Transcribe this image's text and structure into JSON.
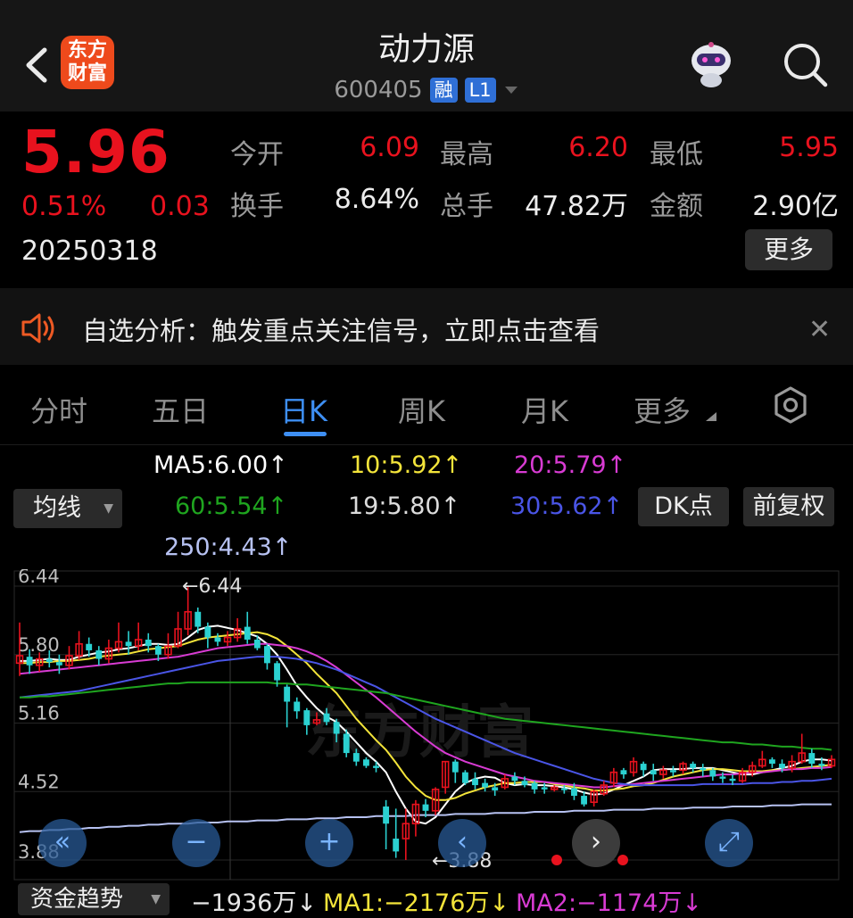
{
  "header": {
    "logo_line1": "东方",
    "logo_line2": "财富",
    "title": "动力源",
    "code": "600405",
    "tag1": "融",
    "tag2": "L1"
  },
  "quote": {
    "price": "5.96",
    "change_pct": "0.51%",
    "change": "0.03",
    "date": "20250318",
    "open_label": "今开",
    "open": "6.09",
    "high_label": "最高",
    "high": "6.20",
    "low_label": "最低",
    "low": "5.95",
    "turnover_label": "换手",
    "turnover": "8.64%",
    "volume_label": "总手",
    "volume": "47.82万",
    "amount_label": "金额",
    "amount": "2.90亿",
    "more_label": "更多"
  },
  "banner": {
    "text": "自选分析：触发重点关注信号，立即点击查看"
  },
  "tabs": [
    "分时",
    "五日",
    "日K",
    "周K",
    "月K",
    "更多"
  ],
  "active_tab": "日K",
  "ma_legend": {
    "ma5": "MA5:6.00↑",
    "ma10": "10:5.92↑",
    "ma20": "20:5.79↑",
    "ma60": "60:5.54↑",
    "ma19": "19:5.80↑",
    "ma30": "30:5.62↑",
    "ma250": "250:4.43↑",
    "line_select": "均线",
    "dk_button": "DK点",
    "adjust_button": "前复权"
  },
  "colors": {
    "up": "#e8121e",
    "down": "#2bd1d1",
    "ma5": "#ffffff",
    "ma10": "#f3e43a",
    "ma20": "#d83bd3",
    "ma60": "#1fa51f",
    "ma30": "#4a55e6",
    "ma250": "#b7c2f2",
    "accent": "#3e8ff3"
  },
  "chart_data": {
    "type": "candlestick",
    "y_ticks": [
      "6.44",
      "5.80",
      "5.16",
      "4.52",
      "3.88"
    ],
    "ylim": [
      3.88,
      6.44
    ],
    "max_label": "←6.44",
    "min_label": "←3.88",
    "watermark": "东方财富",
    "candles": [
      [
        5.72,
        5.79,
        6.1,
        5.6
      ],
      [
        5.78,
        5.7,
        5.85,
        5.62
      ],
      [
        5.7,
        5.76,
        5.82,
        5.64
      ],
      [
        5.76,
        5.73,
        5.84,
        5.68
      ],
      [
        5.73,
        5.7,
        5.8,
        5.62
      ],
      [
        5.7,
        5.79,
        5.88,
        5.66
      ],
      [
        5.79,
        5.9,
        6.02,
        5.75
      ],
      [
        5.9,
        5.84,
        5.96,
        5.78
      ],
      [
        5.84,
        5.76,
        5.88,
        5.7
      ],
      [
        5.76,
        5.86,
        5.94,
        5.72
      ],
      [
        5.86,
        5.92,
        6.1,
        5.82
      ],
      [
        5.92,
        5.88,
        6.02,
        5.8
      ],
      [
        5.88,
        5.94,
        6.1,
        5.84
      ],
      [
        5.94,
        5.88,
        6.0,
        5.82
      ],
      [
        5.88,
        5.8,
        5.9,
        5.74
      ],
      [
        5.8,
        5.88,
        6.0,
        5.76
      ],
      [
        5.88,
        6.04,
        6.2,
        5.86
      ],
      [
        6.04,
        6.2,
        6.44,
        5.98
      ],
      [
        6.2,
        6.06,
        6.24,
        6.0
      ],
      [
        6.06,
        5.96,
        6.1,
        5.86
      ],
      [
        5.96,
        5.92,
        6.0,
        5.88
      ],
      [
        5.92,
        5.96,
        6.02,
        5.88
      ],
      [
        5.96,
        6.04,
        6.14,
        5.92
      ],
      [
        6.06,
        5.94,
        6.2,
        5.9
      ],
      [
        5.94,
        5.86,
        5.98,
        5.84
      ],
      [
        5.88,
        5.72,
        5.9,
        5.66
      ],
      [
        5.72,
        5.56,
        5.74,
        5.5
      ],
      [
        5.5,
        5.36,
        5.52,
        5.12
      ],
      [
        5.36,
        5.27,
        5.4,
        5.2
      ],
      [
        5.28,
        5.14,
        5.3,
        5.05
      ],
      [
        5.16,
        5.19,
        5.26,
        5.14
      ],
      [
        5.25,
        5.17,
        5.3,
        5.14
      ],
      [
        5.17,
        5.06,
        5.2,
        4.98
      ],
      [
        5.06,
        4.88,
        5.1,
        4.84
      ],
      [
        4.88,
        4.8,
        4.92,
        4.76
      ],
      [
        4.82,
        4.76,
        4.84,
        4.74
      ],
      [
        4.76,
        4.74,
        4.8,
        4.7
      ],
      [
        4.38,
        4.22,
        4.44,
        3.98
      ],
      [
        4.08,
        3.96,
        4.36,
        3.9
      ],
      [
        4.08,
        4.22,
        4.36,
        3.88
      ],
      [
        4.22,
        4.4,
        4.44,
        4.1
      ],
      [
        4.4,
        4.34,
        4.45,
        4.28
      ],
      [
        4.34,
        4.54,
        4.56,
        4.3
      ],
      [
        4.56,
        4.8,
        4.8,
        4.5
      ],
      [
        4.8,
        4.7,
        4.82,
        4.6
      ],
      [
        4.7,
        4.6,
        4.72,
        4.58
      ],
      [
        4.64,
        4.58,
        4.7,
        4.54
      ],
      [
        4.6,
        4.56,
        4.64,
        4.52
      ],
      [
        4.56,
        4.53,
        4.6,
        4.48
      ],
      [
        4.56,
        4.64,
        4.68,
        4.54
      ],
      [
        4.66,
        4.62,
        4.7,
        4.58
      ],
      [
        4.62,
        4.58,
        4.66,
        4.56
      ],
      [
        4.6,
        4.54,
        4.62,
        4.5
      ],
      [
        4.56,
        4.54,
        4.6,
        4.5
      ],
      [
        4.54,
        4.56,
        4.58,
        4.52
      ],
      [
        4.55,
        4.54,
        4.58,
        4.5
      ],
      [
        4.55,
        4.48,
        4.6,
        4.44
      ],
      [
        4.48,
        4.4,
        4.52,
        4.38
      ],
      [
        4.42,
        4.52,
        4.54,
        4.38
      ],
      [
        4.5,
        4.58,
        4.62,
        4.48
      ],
      [
        4.6,
        4.7,
        4.74,
        4.56
      ],
      [
        4.72,
        4.68,
        4.74,
        4.64
      ],
      [
        4.7,
        4.8,
        4.84,
        4.66
      ],
      [
        4.78,
        4.72,
        4.8,
        4.66
      ],
      [
        4.72,
        4.68,
        4.78,
        4.62
      ],
      [
        4.68,
        4.72,
        4.76,
        4.64
      ],
      [
        4.72,
        4.7,
        4.76,
        4.66
      ],
      [
        4.72,
        4.78,
        4.8,
        4.68
      ],
      [
        4.78,
        4.74,
        4.8,
        4.7
      ],
      [
        4.74,
        4.72,
        4.78,
        4.66
      ],
      [
        4.72,
        4.66,
        4.74,
        4.62
      ],
      [
        4.66,
        4.64,
        4.7,
        4.6
      ],
      [
        4.64,
        4.62,
        4.68,
        4.58
      ],
      [
        4.62,
        4.7,
        4.74,
        4.6
      ],
      [
        4.7,
        4.76,
        4.8,
        4.66
      ],
      [
        4.76,
        4.82,
        4.9,
        4.74
      ],
      [
        4.82,
        4.78,
        4.84,
        4.74
      ],
      [
        4.78,
        4.74,
        4.82,
        4.7
      ],
      [
        4.74,
        4.8,
        4.86,
        4.7
      ],
      [
        4.8,
        4.88,
        5.06,
        4.78
      ],
      [
        4.88,
        4.78,
        4.92,
        4.74
      ],
      [
        4.78,
        4.76,
        4.84,
        4.72
      ],
      [
        4.76,
        4.82,
        4.86,
        4.74
      ]
    ],
    "series": [
      {
        "name": "MA5",
        "color": "#ffffff",
        "values": [
          5.74,
          5.74,
          5.75,
          5.76,
          5.75,
          5.75,
          5.78,
          5.8,
          5.82,
          5.83,
          5.85,
          5.86,
          5.88,
          5.9,
          5.9,
          5.89,
          5.9,
          5.96,
          6.03,
          6.06,
          6.07,
          6.05,
          6.03,
          6.0,
          5.97,
          5.9,
          5.8,
          5.66,
          5.51,
          5.4,
          5.3,
          5.22,
          5.17,
          5.08,
          4.98,
          4.88,
          4.8,
          4.7,
          4.52,
          4.36,
          4.24,
          4.22,
          4.28,
          4.4,
          4.52,
          4.6,
          4.64,
          4.66,
          4.65,
          4.6,
          4.58,
          4.59,
          4.58,
          4.58,
          4.57,
          4.56,
          4.54,
          4.51,
          4.49,
          4.5,
          4.54,
          4.58,
          4.62,
          4.66,
          4.72,
          4.73,
          4.73,
          4.73,
          4.74,
          4.74,
          4.74,
          4.72,
          4.7,
          4.68,
          4.68,
          4.7,
          4.72,
          4.74,
          4.76,
          4.8,
          4.82,
          4.82,
          4.81
        ]
      },
      {
        "name": "MA10",
        "color": "#f3e43a",
        "values": [
          5.72,
          5.72,
          5.73,
          5.73,
          5.74,
          5.74,
          5.75,
          5.76,
          5.78,
          5.79,
          5.8,
          5.81,
          5.83,
          5.85,
          5.86,
          5.87,
          5.88,
          5.91,
          5.94,
          5.96,
          5.97,
          5.98,
          5.99,
          6.0,
          6.01,
          5.99,
          5.95,
          5.88,
          5.8,
          5.72,
          5.62,
          5.53,
          5.44,
          5.32,
          5.2,
          5.1,
          5.0,
          4.91,
          4.79,
          4.66,
          4.56,
          4.48,
          4.44,
          4.44,
          4.46,
          4.5,
          4.53,
          4.56,
          4.58,
          4.6,
          4.6,
          4.61,
          4.61,
          4.61,
          4.59,
          4.58,
          4.56,
          4.55,
          4.53,
          4.53,
          4.54,
          4.55,
          4.57,
          4.58,
          4.6,
          4.63,
          4.66,
          4.68,
          4.7,
          4.72,
          4.73,
          4.73,
          4.72,
          4.71,
          4.71,
          4.71,
          4.72,
          4.72,
          4.73,
          4.74,
          4.75,
          4.76,
          4.77
        ]
      },
      {
        "name": "MA20",
        "color": "#d83bd3",
        "values": [
          5.62,
          5.63,
          5.64,
          5.65,
          5.66,
          5.67,
          5.68,
          5.69,
          5.7,
          5.71,
          5.72,
          5.73,
          5.74,
          5.75,
          5.76,
          5.77,
          5.78,
          5.8,
          5.82,
          5.84,
          5.86,
          5.87,
          5.88,
          5.89,
          5.9,
          5.9,
          5.89,
          5.88,
          5.86,
          5.83,
          5.79,
          5.74,
          5.68,
          5.61,
          5.54,
          5.47,
          5.4,
          5.32,
          5.24,
          5.16,
          5.08,
          5.01,
          4.94,
          4.88,
          4.84,
          4.8,
          4.77,
          4.74,
          4.71,
          4.68,
          4.66,
          4.64,
          4.62,
          4.61,
          4.6,
          4.59,
          4.58,
          4.57,
          4.56,
          4.56,
          4.57,
          4.58,
          4.59,
          4.6,
          4.61,
          4.62,
          4.63,
          4.64,
          4.65,
          4.66,
          4.67,
          4.68,
          4.68,
          4.69,
          4.7,
          4.7,
          4.71,
          4.72,
          4.73,
          4.73,
          4.74,
          4.74,
          4.75
        ]
      },
      {
        "name": "MA30",
        "color": "#4a55e6",
        "values": [
          5.4,
          5.41,
          5.42,
          5.43,
          5.44,
          5.45,
          5.46,
          5.48,
          5.5,
          5.52,
          5.54,
          5.56,
          5.58,
          5.6,
          5.62,
          5.64,
          5.66,
          5.68,
          5.7,
          5.72,
          5.74,
          5.75,
          5.76,
          5.77,
          5.78,
          5.78,
          5.78,
          5.77,
          5.76,
          5.74,
          5.72,
          5.69,
          5.66,
          5.62,
          5.58,
          5.54,
          5.5,
          5.45,
          5.4,
          5.35,
          5.3,
          5.25,
          5.2,
          5.16,
          5.12,
          5.08,
          5.04,
          5.0,
          4.96,
          4.92,
          4.88,
          4.85,
          4.82,
          4.79,
          4.76,
          4.73,
          4.7,
          4.67,
          4.64,
          4.62,
          4.6,
          4.59,
          4.58,
          4.58,
          4.58,
          4.58,
          4.58,
          4.58,
          4.58,
          4.59,
          4.59,
          4.59,
          4.59,
          4.59,
          4.6,
          4.6,
          4.6,
          4.61,
          4.61,
          4.62,
          4.62,
          4.63,
          4.64
        ]
      },
      {
        "name": "MA60",
        "color": "#1fa51f",
        "values": [
          5.4,
          5.4,
          5.41,
          5.41,
          5.42,
          5.43,
          5.44,
          5.45,
          5.46,
          5.47,
          5.48,
          5.49,
          5.5,
          5.51,
          5.52,
          5.53,
          5.53,
          5.54,
          5.54,
          5.54,
          5.54,
          5.54,
          5.54,
          5.54,
          5.54,
          5.54,
          5.53,
          5.53,
          5.52,
          5.52,
          5.51,
          5.5,
          5.49,
          5.48,
          5.47,
          5.46,
          5.45,
          5.44,
          5.42,
          5.4,
          5.38,
          5.36,
          5.34,
          5.32,
          5.3,
          5.28,
          5.26,
          5.24,
          5.22,
          5.2,
          5.19,
          5.18,
          5.17,
          5.16,
          5.15,
          5.14,
          5.13,
          5.12,
          5.11,
          5.1,
          5.09,
          5.08,
          5.07,
          5.06,
          5.05,
          5.04,
          5.03,
          5.02,
          5.01,
          5.0,
          4.99,
          4.98,
          4.98,
          4.97,
          4.96,
          4.96,
          4.95,
          4.94,
          4.94,
          4.93,
          4.92,
          4.92,
          4.91
        ]
      },
      {
        "name": "MA250",
        "color": "#b7c2f2",
        "values": [
          4.14,
          4.15,
          4.15,
          4.16,
          4.16,
          4.17,
          4.17,
          4.18,
          4.18,
          4.19,
          4.19,
          4.2,
          4.2,
          4.21,
          4.21,
          4.22,
          4.22,
          4.22,
          4.23,
          4.23,
          4.23,
          4.24,
          4.24,
          4.24,
          4.25,
          4.25,
          4.25,
          4.26,
          4.26,
          4.26,
          4.27,
          4.27,
          4.27,
          4.28,
          4.28,
          4.28,
          4.29,
          4.29,
          4.29,
          4.29,
          4.3,
          4.3,
          4.3,
          4.3,
          4.31,
          4.31,
          4.31,
          4.31,
          4.32,
          4.32,
          4.32,
          4.32,
          4.33,
          4.33,
          4.33,
          4.33,
          4.34,
          4.34,
          4.34,
          4.34,
          4.35,
          4.35,
          4.35,
          4.35,
          4.36,
          4.36,
          4.36,
          4.36,
          4.37,
          4.37,
          4.37,
          4.37,
          4.38,
          4.38,
          4.38,
          4.38,
          4.39,
          4.39,
          4.39,
          4.4,
          4.4,
          4.4,
          4.4
        ]
      }
    ]
  },
  "overlay": {
    "rewind": "«",
    "zoom_out": "−",
    "zoom_in": "+",
    "prev": "‹",
    "next": "›",
    "fullscreen": "⤢"
  },
  "indicator": {
    "select": "资金趋势",
    "value": "−1936万↓",
    "ma1": "MA1:−2176万↓",
    "ma2": "MA2:−1174万↓"
  }
}
